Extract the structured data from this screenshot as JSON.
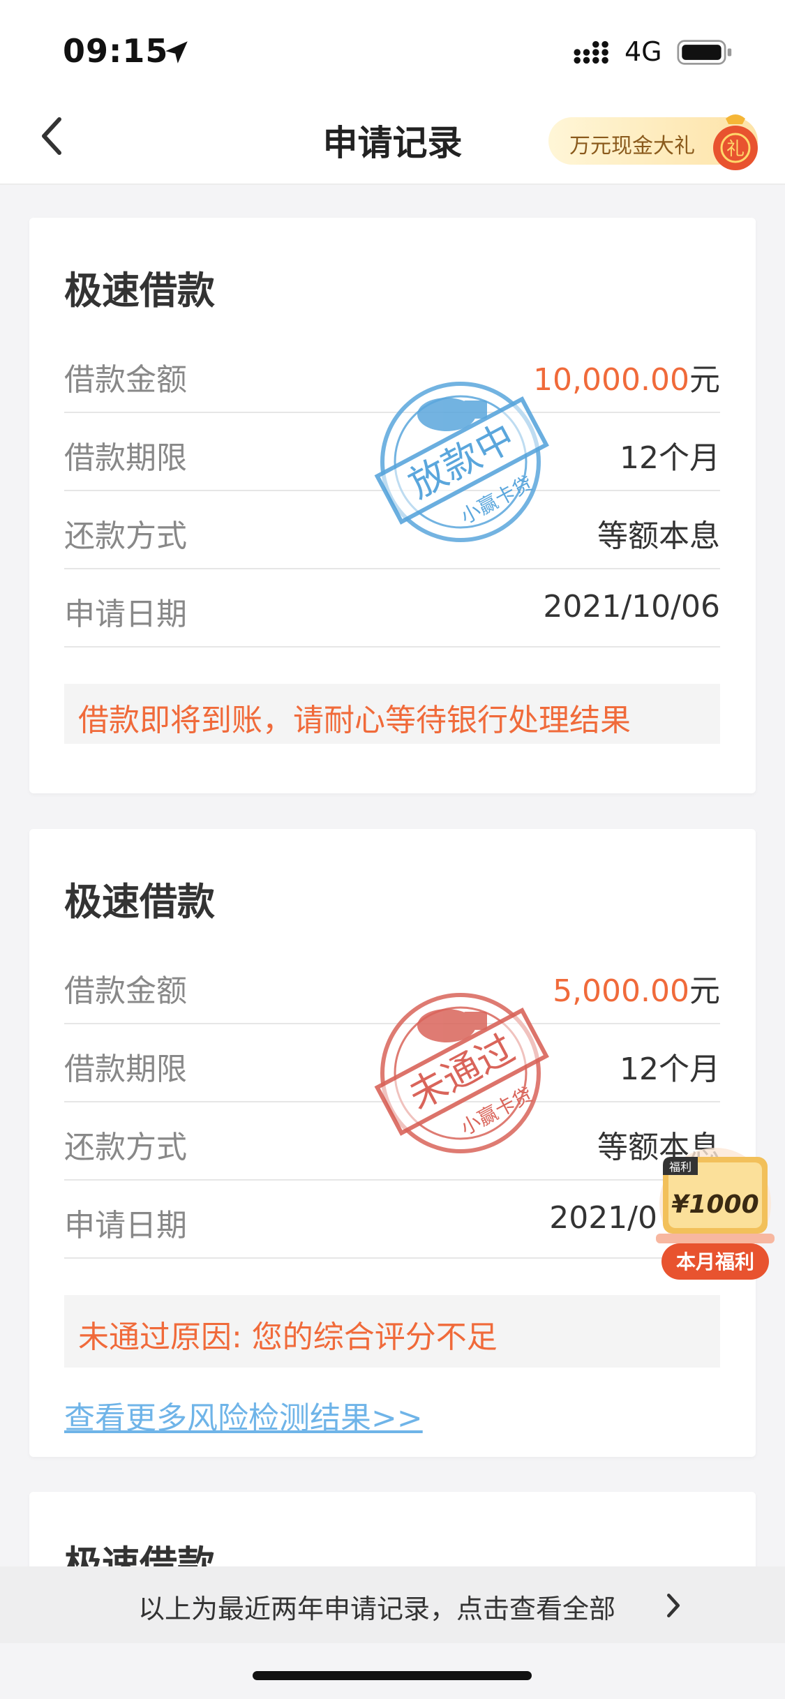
{
  "status_bar": {
    "time": "09:15",
    "network": "4G"
  },
  "nav": {
    "title": "申请记录",
    "promo_label": "万元现金大礼",
    "promo_bag_char": "礼"
  },
  "cards": [
    {
      "title": "极速借款",
      "rows": [
        {
          "label": "借款金额",
          "amount": "10,000.00",
          "unit": "元"
        },
        {
          "label": "借款期限",
          "value": "12个月"
        },
        {
          "label": "还款方式",
          "value": "等额本息"
        },
        {
          "label": "申请日期",
          "value": "2021/10/06"
        }
      ],
      "note": "借款即将到账，请耐心等待银行处理结果",
      "stamp": {
        "status": "放款中",
        "brand": "小赢卡贷",
        "color": "#5aa6dc"
      }
    },
    {
      "title": "极速借款",
      "rows": [
        {
          "label": "借款金额",
          "amount": "5,000.00",
          "unit": "元"
        },
        {
          "label": "借款期限",
          "value": "12个月"
        },
        {
          "label": "还款方式",
          "value": "等额本息"
        },
        {
          "label": "申请日期",
          "value": "2021/0"
        }
      ],
      "note": "未通过原因: 您的综合评分不足",
      "link": "查看更多风险检测结果>>",
      "stamp": {
        "status": "未通过",
        "brand": "小赢卡贷",
        "color": "#d9645a"
      }
    },
    {
      "title": "极速借款"
    }
  ],
  "float_badge": {
    "tag": "福利",
    "amount": "¥1000",
    "label": "本月福利"
  },
  "bottom_bar": {
    "text": "以上为最近两年申请记录，点击查看全部"
  },
  "colors": {
    "accent_orange": "#f06a3a",
    "link_blue": "#6fb4e8",
    "stamp_blue": "#5aa6dc",
    "stamp_red": "#d9645a"
  }
}
